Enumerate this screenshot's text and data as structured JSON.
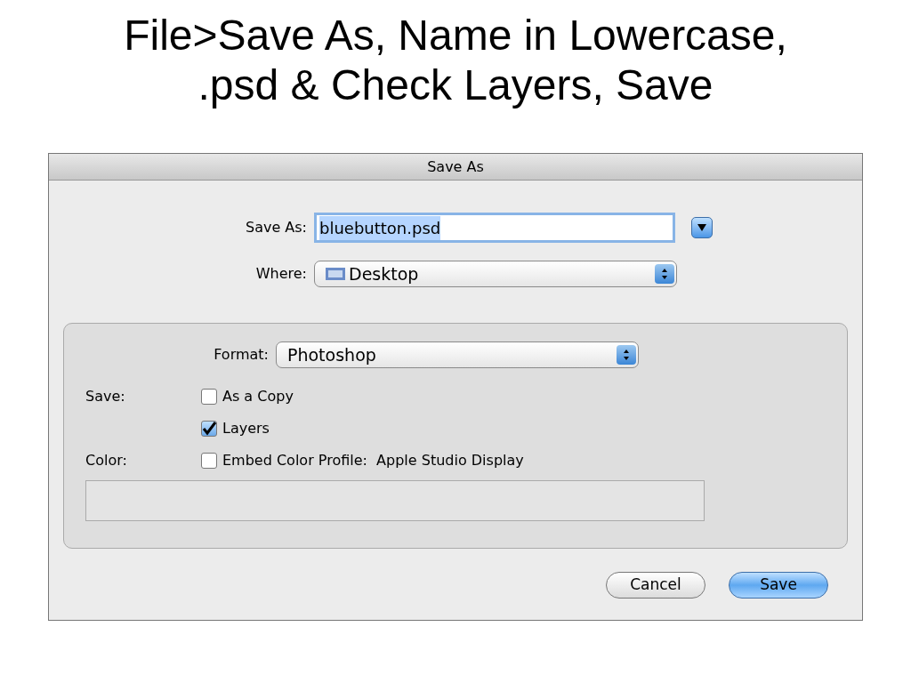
{
  "slide_title": [
    "File>Save As, Name in Lowercase,",
    ".psd & Check Layers, Save"
  ],
  "window": {
    "title": "Save As"
  },
  "save_as": {
    "label": "Save As:",
    "value": "bluebutton.psd"
  },
  "where": {
    "label": "Where:",
    "value": "Desktop"
  },
  "format": {
    "label": "Format:",
    "value": "Photoshop"
  },
  "options": [
    {
      "section": "Save:",
      "label": "As a Copy",
      "checked": false
    },
    {
      "label": "Layers",
      "checked": true
    },
    {
      "section": "Color:",
      "label": "Embed Color Profile:  Apple Studio Display",
      "checked": false
    }
  ],
  "buttons": [
    {
      "label": "Cancel",
      "kind": "normal"
    },
    {
      "label": "Save",
      "kind": "default"
    }
  ]
}
